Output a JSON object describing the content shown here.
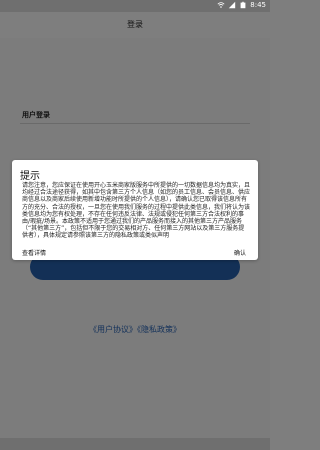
{
  "status_bar": {
    "time": "8:45",
    "icons": [
      "wifi-icon",
      "signal-icon",
      "battery-icon"
    ]
  },
  "header": {
    "title": "登录"
  },
  "main": {
    "section_title": "用户登录",
    "agreements": "《用户协议》《隐私政策》"
  },
  "dialog": {
    "title": "提示",
    "body": "请您注意，您应保证在使用开心玉米商家版服务中所提供的一切数据信息均为真实，且均经过合法途径获得，如其中包含第三方个人信息（如您的员工信息、会员信息、供应商信息以及商家后续使用新增功能时所提供的个人信息），请确认您已取得该信息所有方的充分、合法的授权，一旦您在使用我们服务的过程中提供此类信息，我们将认为该类信息均为您有权处理，不存在任何违反法律、法规或侵犯任何第三方合法权利的事由/瑕疵/场景。本政策不适用于您通过我们的产品服务而接入的其他第三方产品服务（“其他第三方”，包括但不限于您的交易相对方、任何第三方网站以及第三方服务提供者），具体规定请参照该第三方的隐私政策或类似声明",
    "left_button": "查看详情",
    "right_button": "确认"
  },
  "colors": {
    "button_bg": "#133056",
    "agreement_text": "#12305a",
    "background_dim": "#7c7c7c"
  }
}
